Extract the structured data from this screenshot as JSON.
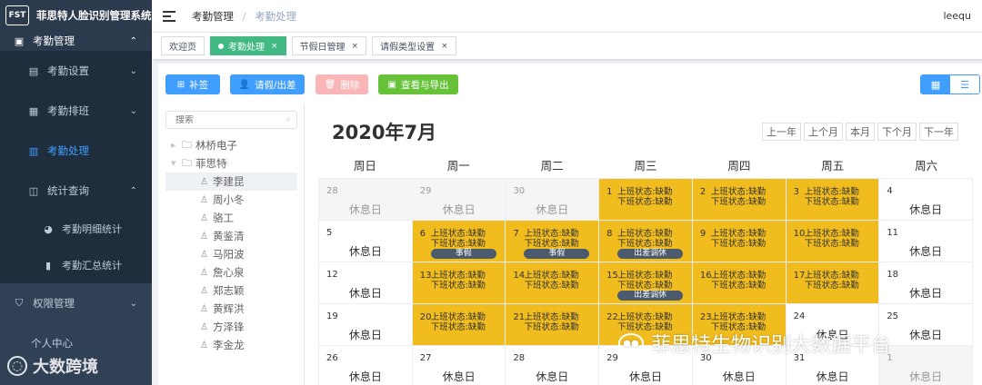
{
  "app": {
    "title": "菲思特人脸识别管理系统",
    "logo_text": "FST"
  },
  "sidebar": {
    "attendance": {
      "label": "考勤管理"
    },
    "items": [
      {
        "label": "考勤设置"
      },
      {
        "label": "考勤排班"
      },
      {
        "label": "考勤处理"
      },
      {
        "label": "统计查询"
      }
    ],
    "stats_items": [
      {
        "label": "考勤明细统计"
      },
      {
        "label": "考勤汇总统计"
      }
    ],
    "permission": {
      "label": "权限管理"
    },
    "personal": {
      "label": "个人中心"
    }
  },
  "header": {
    "breadcrumb": [
      "考勤管理",
      "考勤处理"
    ],
    "user": "leequ"
  },
  "tabs": [
    {
      "label": "欢迎页",
      "active": false,
      "closable": false
    },
    {
      "label": "考勤处理",
      "active": true,
      "closable": true
    },
    {
      "label": "节假日管理",
      "active": false,
      "closable": true
    },
    {
      "label": "请假类型设置",
      "active": false,
      "closable": true
    }
  ],
  "toolbar": {
    "supplement": "补签",
    "leave": "请假/出差",
    "delete": "删除",
    "export": "查看与导出"
  },
  "tree": {
    "search_placeholder": "搜索",
    "companies": [
      {
        "label": "林桥电子",
        "expanded": false
      },
      {
        "label": "菲思特",
        "expanded": true
      }
    ],
    "people": [
      "李建昆",
      "周小冬",
      "骆工",
      "黄鉴清",
      "马阳波",
      "詹心泉",
      "郑志颖",
      "黄辉洪",
      "方泽锋",
      "李金龙"
    ],
    "selected": "李建昆"
  },
  "calendar": {
    "title": "2020年7月",
    "nav": [
      "上一年",
      "上个月",
      "本月",
      "下个月",
      "下一年"
    ],
    "weekdays": [
      "周日",
      "周一",
      "周二",
      "周三",
      "周四",
      "周五",
      "周六"
    ],
    "rest_label": "休息日",
    "status_line1": "上班状态:缺勤",
    "status_line2": "下班状态:缺勤",
    "colors": {
      "absent": "#f1bc1e",
      "badge": "#4b5a6d",
      "other_month": "#f5f5f5"
    },
    "weeks": [
      [
        {
          "d": "28",
          "t": "rest",
          "o": true
        },
        {
          "d": "29",
          "t": "rest",
          "o": true
        },
        {
          "d": "30",
          "t": "rest",
          "o": true
        },
        {
          "d": "1",
          "t": "absent"
        },
        {
          "d": "2",
          "t": "absent"
        },
        {
          "d": "3",
          "t": "absent"
        },
        {
          "d": "4",
          "t": "rest"
        }
      ],
      [
        {
          "d": "5",
          "t": "rest"
        },
        {
          "d": "6",
          "t": "absent",
          "b": "事假"
        },
        {
          "d": "7",
          "t": "absent",
          "b": "事假"
        },
        {
          "d": "8",
          "t": "absent",
          "b": "出差调休"
        },
        {
          "d": "9",
          "t": "absent"
        },
        {
          "d": "10",
          "t": "absent"
        },
        {
          "d": "11",
          "t": "rest"
        }
      ],
      [
        {
          "d": "12",
          "t": "rest"
        },
        {
          "d": "13",
          "t": "absent"
        },
        {
          "d": "14",
          "t": "absent"
        },
        {
          "d": "15",
          "t": "absent",
          "b": "出差调休"
        },
        {
          "d": "16",
          "t": "absent"
        },
        {
          "d": "17",
          "t": "absent"
        },
        {
          "d": "18",
          "t": "rest"
        }
      ],
      [
        {
          "d": "19",
          "t": "rest"
        },
        {
          "d": "20",
          "t": "absent"
        },
        {
          "d": "21",
          "t": "absent"
        },
        {
          "d": "22",
          "t": "absent"
        },
        {
          "d": "23",
          "t": "absent"
        },
        {
          "d": "24",
          "t": "rest"
        },
        {
          "d": "25",
          "t": "rest"
        }
      ],
      [
        {
          "d": "26",
          "t": "rest"
        },
        {
          "d": "27",
          "t": "rest"
        },
        {
          "d": "28",
          "t": "rest"
        },
        {
          "d": "29",
          "t": "rest"
        },
        {
          "d": "30",
          "t": "rest"
        },
        {
          "d": "31",
          "t": "rest"
        },
        {
          "d": "1",
          "t": "rest",
          "o": true
        }
      ]
    ]
  },
  "watermarks": {
    "left": "大数跨境",
    "right": "菲思特生物识别大数据平台"
  }
}
